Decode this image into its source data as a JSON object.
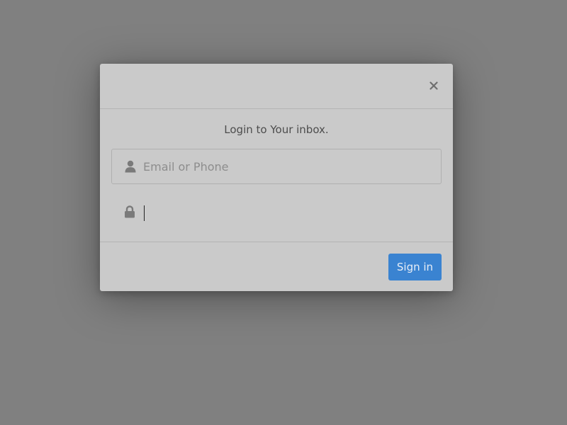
{
  "modal": {
    "subtitle": "Login to Your inbox.",
    "close_icon": "close-icon",
    "fields": {
      "email": {
        "icon": "user-icon",
        "placeholder": "Email or Phone",
        "value": ""
      },
      "password": {
        "icon": "lock-icon",
        "placeholder": "",
        "value": ""
      }
    },
    "submit_label": "Sign in"
  },
  "colors": {
    "backdrop": "#808080",
    "modal_bg": "#cacaca",
    "primary_button": "#3a83d1",
    "divider": "#b4b4b4"
  }
}
